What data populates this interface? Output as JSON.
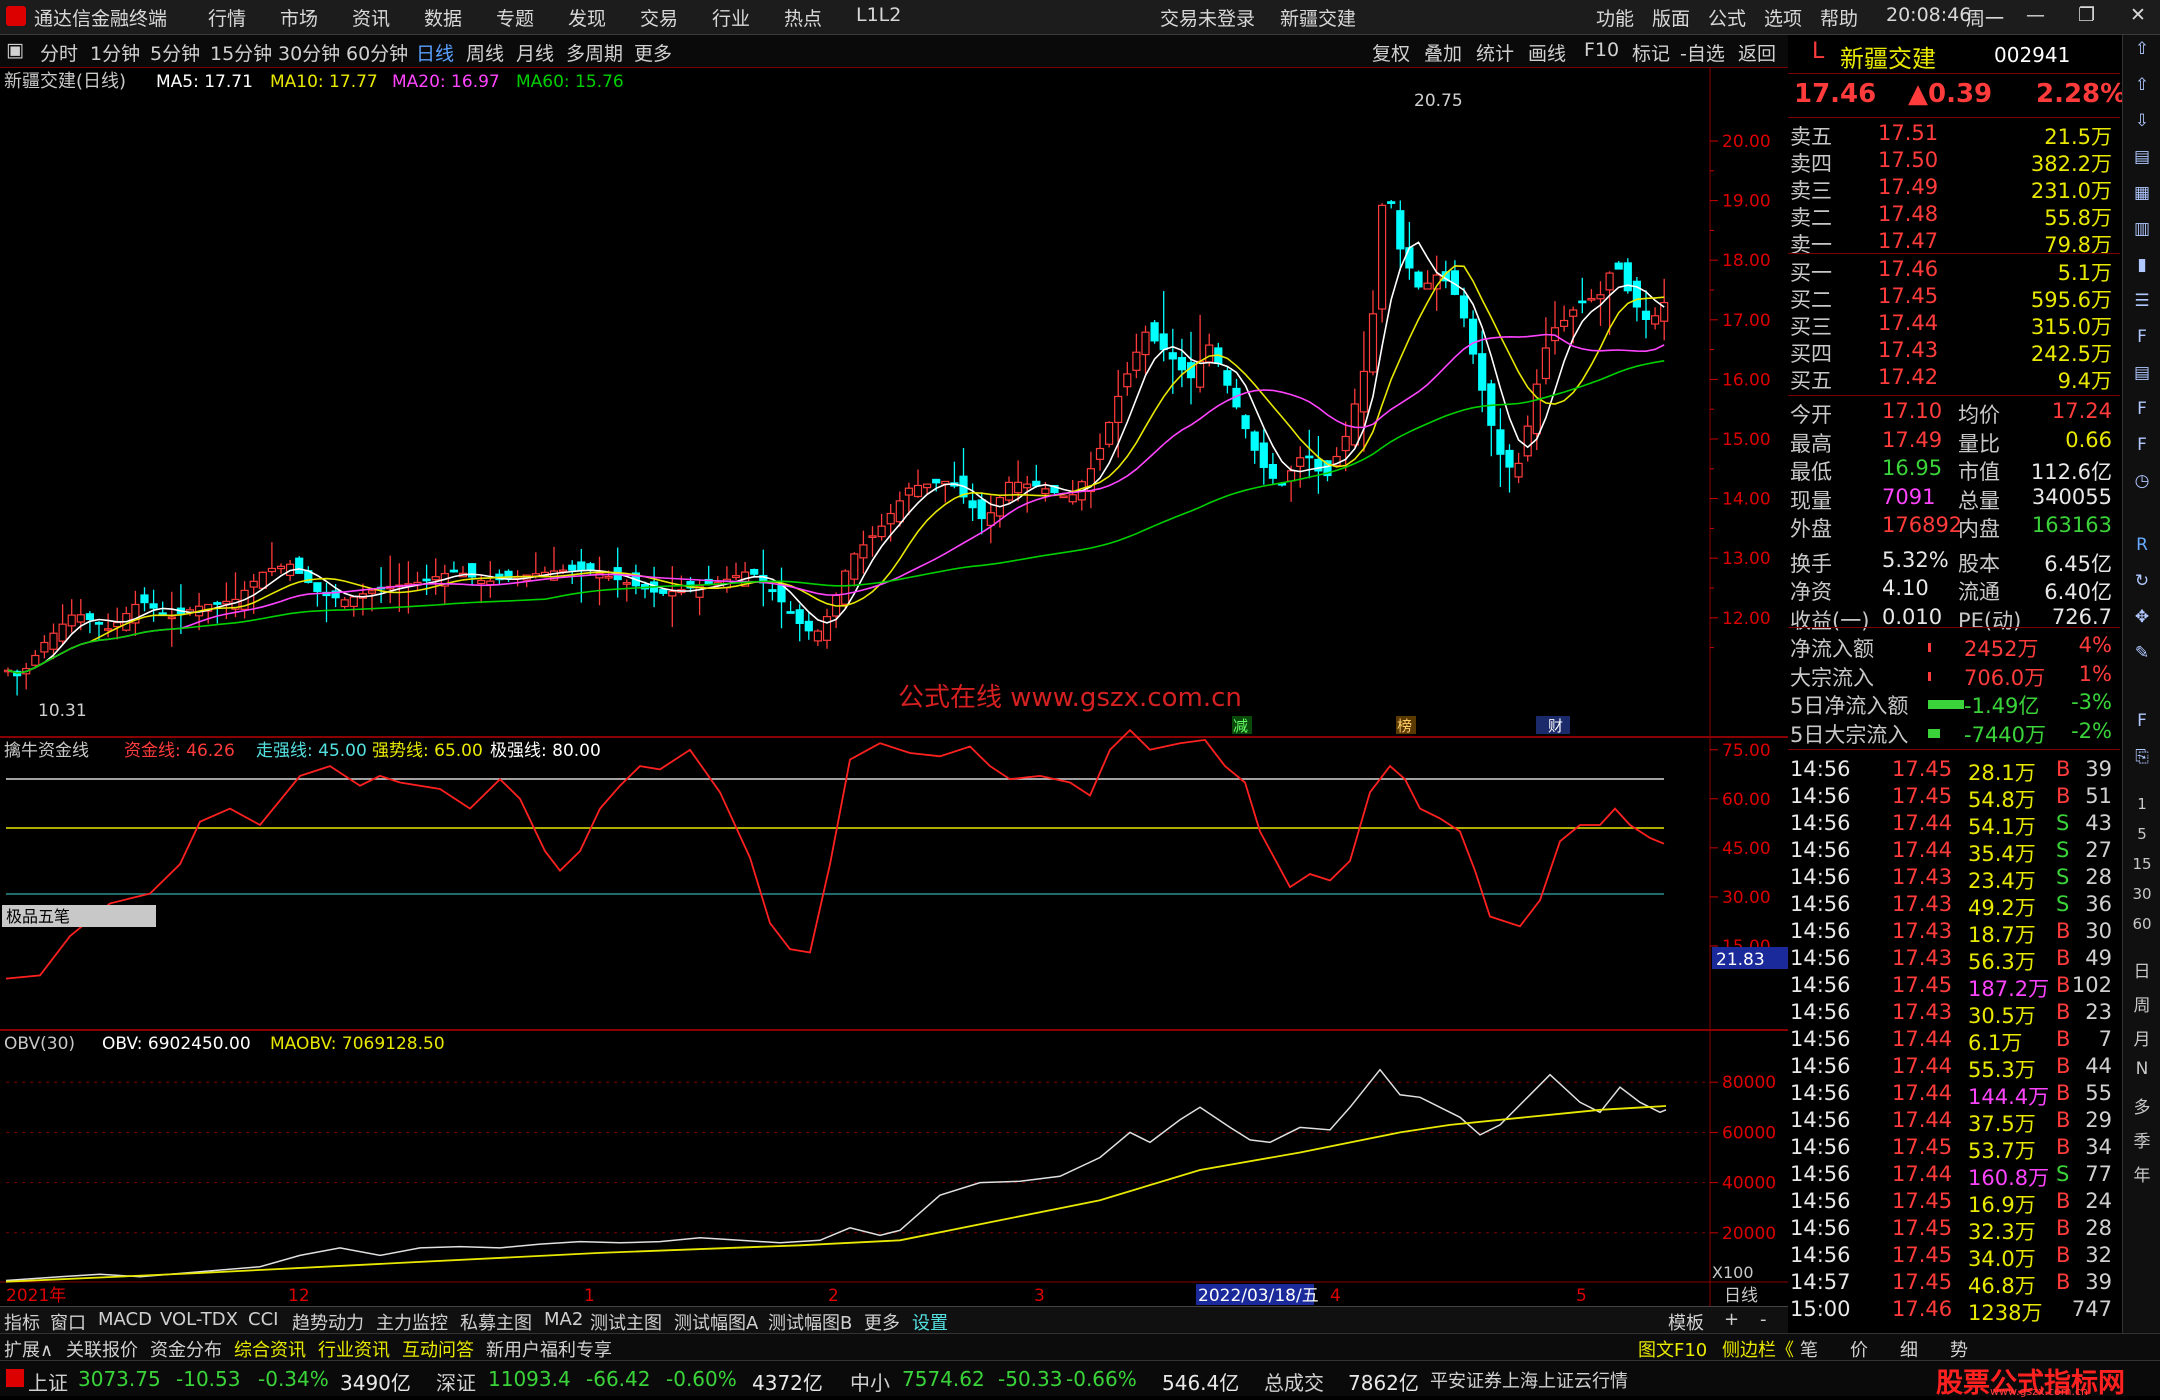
{
  "menubar": {
    "app_title": "通达信金融终端",
    "items": [
      "行情",
      "市场",
      "资讯",
      "数据",
      "专题",
      "发现",
      "交易",
      "行业",
      "热点",
      "L1L2"
    ],
    "login_status": "交易未登录",
    "stock_name_center": "新疆交建",
    "right_items": [
      "功能",
      "版面",
      "公式",
      "选项",
      "帮助"
    ],
    "time": "20:08:46",
    "weekday": "周一"
  },
  "periodbar": {
    "periods": [
      "分时",
      "1分钟",
      "5分钟",
      "15分钟",
      "30分钟",
      "60分钟",
      "日线",
      "周线",
      "月线",
      "多周期",
      "更多"
    ],
    "active": "日线",
    "tools": [
      "复权",
      "叠加",
      "统计",
      "画线",
      "F10",
      "标记",
      "-自选",
      "返回"
    ]
  },
  "main_chart": {
    "title": "新疆交建(日线)",
    "ma5": "MA5: 17.71",
    "ma10": "MA10: 17.77",
    "ma20": "MA20: 16.97",
    "ma60": "MA60: 15.76",
    "high_label": "20.75",
    "low_label": "10.31",
    "y_ticks": [
      "20.00",
      "19.00",
      "18.00",
      "17.00",
      "16.00",
      "15.00",
      "14.00",
      "13.00",
      "12.00"
    ],
    "watermark": "公式在线  www.gszx.com.cn",
    "event_tags": [
      "减",
      "榜",
      "财"
    ]
  },
  "indicator1": {
    "name": "擒牛资金线",
    "zj": "资金线: 46.26",
    "zq": "走强线: 45.00",
    "qs": "强势线: 65.00",
    "jq": "极强线: 80.00",
    "y_ticks": [
      "75.00",
      "60.00",
      "45.00",
      "30.00",
      "15.00"
    ],
    "current_badge": "21.83",
    "toolbar_label": "极品五笔"
  },
  "indicator2": {
    "name": "OBV(30)",
    "obv": "OBV: 6902450.00",
    "maobv": "MAOBV: 7069128.50",
    "y_ticks": [
      "80000",
      "60000",
      "40000",
      "20000"
    ],
    "unit": "X100"
  },
  "x_axis": {
    "labels": [
      "2021年",
      "12",
      "1",
      "2",
      "3",
      "4",
      "5"
    ],
    "cursor_date": "2022/03/18/五",
    "period": "日线"
  },
  "quote": {
    "name": "新疆交建",
    "code": "002941",
    "price": "17.46",
    "change": "▲0.39",
    "pct": "2.28%",
    "asks": [
      {
        "label": "卖五",
        "price": "17.51",
        "vol": "21.5万"
      },
      {
        "label": "卖四",
        "price": "17.50",
        "vol": "382.2万"
      },
      {
        "label": "卖三",
        "price": "17.49",
        "vol": "231.0万"
      },
      {
        "label": "卖二",
        "price": "17.48",
        "vol": "55.8万"
      },
      {
        "label": "卖一",
        "price": "17.47",
        "vol": "79.8万"
      }
    ],
    "bids": [
      {
        "label": "买一",
        "price": "17.46",
        "vol": "5.1万"
      },
      {
        "label": "买二",
        "price": "17.45",
        "vol": "595.6万"
      },
      {
        "label": "买三",
        "price": "17.44",
        "vol": "315.0万"
      },
      {
        "label": "买四",
        "price": "17.43",
        "vol": "242.5万"
      },
      {
        "label": "买五",
        "price": "17.42",
        "vol": "9.4万"
      }
    ],
    "stats": [
      {
        "k1": "今开",
        "v1": "17.10",
        "k2": "均价",
        "v2": "17.24"
      },
      {
        "k1": "最高",
        "v1": "17.49",
        "k2": "量比",
        "v2": "0.66"
      },
      {
        "k1": "最低",
        "v1": "16.95",
        "k2": "市值",
        "v2": "112.6亿"
      },
      {
        "k1": "现量",
        "v1": "7091",
        "k2": "总量",
        "v2": "340055"
      },
      {
        "k1": "外盘",
        "v1": "176892",
        "k2": "内盘",
        "v2": "163163"
      },
      {
        "k1": "换手",
        "v1": "5.32%",
        "k2": "股本",
        "v2": "6.45亿"
      },
      {
        "k1": "净资",
        "v1": "4.10",
        "k2": "流通",
        "v2": "6.40亿"
      },
      {
        "k1": "收益(一)",
        "v1": "0.010",
        "k2": "PE(动)",
        "v2": "726.7"
      }
    ],
    "flows": [
      {
        "label": "净流入额",
        "value": "2452万",
        "pct": "4%"
      },
      {
        "label": "大宗流入",
        "value": "706.0万",
        "pct": "1%"
      },
      {
        "label": "5日净流入额",
        "value": "-1.49亿",
        "pct": "-3%"
      },
      {
        "label": "5日大宗流入",
        "value": "-7440万",
        "pct": "-2%"
      }
    ],
    "ticks": [
      {
        "t": "14:56",
        "p": "17.45",
        "v": "28.1万",
        "s": "B",
        "n": "39"
      },
      {
        "t": "14:56",
        "p": "17.45",
        "v": "54.8万",
        "s": "B",
        "n": "51"
      },
      {
        "t": "14:56",
        "p": "17.44",
        "v": "54.1万",
        "s": "S",
        "n": "43"
      },
      {
        "t": "14:56",
        "p": "17.44",
        "v": "35.4万",
        "s": "S",
        "n": "27"
      },
      {
        "t": "14:56",
        "p": "17.43",
        "v": "23.4万",
        "s": "S",
        "n": "28"
      },
      {
        "t": "14:56",
        "p": "17.43",
        "v": "49.2万",
        "s": "S",
        "n": "36"
      },
      {
        "t": "14:56",
        "p": "17.43",
        "v": "18.7万",
        "s": "B",
        "n": "30"
      },
      {
        "t": "14:56",
        "p": "17.43",
        "v": "56.3万",
        "s": "B",
        "n": "49"
      },
      {
        "t": "14:56",
        "p": "17.45",
        "v": "187.2万",
        "s": "B",
        "n": "102"
      },
      {
        "t": "14:56",
        "p": "17.43",
        "v": "30.5万",
        "s": "B",
        "n": "23"
      },
      {
        "t": "14:56",
        "p": "17.44",
        "v": "6.1万",
        "s": "B",
        "n": "7"
      },
      {
        "t": "14:56",
        "p": "17.44",
        "v": "55.3万",
        "s": "B",
        "n": "44"
      },
      {
        "t": "14:56",
        "p": "17.44",
        "v": "144.4万",
        "s": "B",
        "n": "55"
      },
      {
        "t": "14:56",
        "p": "17.44",
        "v": "37.5万",
        "s": "B",
        "n": "29"
      },
      {
        "t": "14:56",
        "p": "17.45",
        "v": "53.7万",
        "s": "B",
        "n": "34"
      },
      {
        "t": "14:56",
        "p": "17.44",
        "v": "160.8万",
        "s": "S",
        "n": "77"
      },
      {
        "t": "14:56",
        "p": "17.45",
        "v": "16.9万",
        "s": "B",
        "n": "24"
      },
      {
        "t": "14:56",
        "p": "17.45",
        "v": "32.3万",
        "s": "B",
        "n": "28"
      },
      {
        "t": "14:56",
        "p": "17.45",
        "v": "34.0万",
        "s": "B",
        "n": "32"
      },
      {
        "t": "14:57",
        "p": "17.45",
        "v": "46.8万",
        "s": "B",
        "n": "39"
      },
      {
        "t": "15:00",
        "p": "17.46",
        "v": "1238万",
        "s": "",
        "n": "747"
      }
    ]
  },
  "tabbar1": [
    "指标",
    "窗口",
    "MACD",
    "VOL-TDX",
    "CCI",
    "趋势动力",
    "主力监控",
    "私募主图",
    "MA2",
    "测试主图",
    "测试幅图A",
    "测试幅图B",
    "更多",
    "设置"
  ],
  "tabbar1_right": [
    "模板",
    "+",
    "-"
  ],
  "tabbar2": [
    "扩展∧",
    "关联报价",
    "资金分布",
    "综合资讯",
    "行业资讯",
    "互动问答",
    "新用户福利专享"
  ],
  "tabbar2_right": [
    "图文F10",
    "侧边栏《",
    "笔",
    "价",
    "细",
    "势"
  ],
  "toolstrip": [
    "日",
    "周",
    "月",
    "N",
    "多",
    "季",
    "年"
  ],
  "statusbar": {
    "sh_label": "上证",
    "sh_val": "3073.75",
    "sh_chg": "-10.53",
    "sh_pct": "-0.34%",
    "sh_amt": "3490亿",
    "sz_label": "深证",
    "sz_val": "11093.4",
    "sz_chg": "-66.42",
    "sz_pct": "-0.60%",
    "sz_amt": "4372亿",
    "zx_label": "中小",
    "zx_val": "7574.62",
    "zx_chg": "-50.33",
    "zx_pct": "-0.66%",
    "zx_amt": "546.4亿",
    "total_label": "总成交",
    "total_amt": "7862亿",
    "source": "平安证券上海上证云行情",
    "logo_text": "股票公式指标网",
    "logo_url": "www.gszx.com.cn"
  },
  "colors": {
    "up": "#ff3b3b",
    "down": "#00ffff",
    "ma5": "#ffffff",
    "ma10": "#e8e800",
    "ma20": "#ff44ff",
    "ma60": "#00d000"
  }
}
